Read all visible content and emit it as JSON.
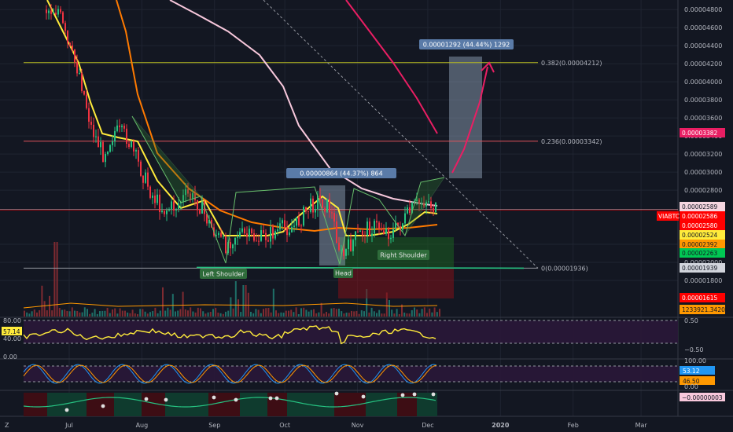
{
  "chart_data": {
    "type": "line",
    "symbol": "VIABTC",
    "x_labels": [
      "Jul",
      "Aug",
      "Sep",
      "Oct",
      "Nov",
      "Dec",
      "2020",
      "Feb",
      "Mar"
    ],
    "y_ticks": [
      "0.00004800",
      "0.00004600",
      "0.00004400",
      "0.00004200",
      "0.00004000",
      "0.00003800",
      "0.00003600",
      "0.00003400",
      "0.00003200",
      "0.00003000",
      "0.00002800",
      "0.00002200",
      "0.00002000",
      "0.00001800"
    ],
    "ylim": [
      1.4e-05,
      4.88e-05
    ],
    "price_tags": [
      {
        "value": "0.00003382",
        "bg": "#e91e63",
        "fg": "#ffffff"
      },
      {
        "value": "0.00002589",
        "bg": "#f5d6e0",
        "fg": "#131722"
      },
      {
        "value": "0.00002586",
        "bg": "#ff0000",
        "fg": "#ffffff",
        "label": "VIABTC"
      },
      {
        "value": "0.00002580",
        "bg": "#ff0000",
        "fg": "#ffffff"
      },
      {
        "value": "0.00002524",
        "bg": "#ffeb3b",
        "fg": "#131722"
      },
      {
        "value": "0.00002392",
        "bg": "#ff9800",
        "fg": "#131722"
      },
      {
        "value": "0.00002263",
        "bg": "#00c853",
        "fg": "#131722"
      },
      {
        "value": "0.00001939",
        "bg": "#d1d4dc",
        "fg": "#131722"
      },
      {
        "value": "0.00001615",
        "bg": "#ff0000",
        "fg": "#ffffff"
      },
      {
        "value": "1233921.34200000",
        "bg": "#ff9800",
        "fg": "#131722"
      }
    ],
    "fib_levels": [
      {
        "ratio": "0.382",
        "label": "0.382(0.00004212)",
        "value": 4.212e-05,
        "color": "#b5b823"
      },
      {
        "ratio": "0.236",
        "label": "0.236(0.00003342)",
        "value": 3.342e-05,
        "color": "#e0525a"
      },
      {
        "ratio": "0",
        "label": "0(0.00001936)",
        "value": 1.936e-05,
        "color": "#9598a1"
      }
    ],
    "price_series": {
      "name": "VIABTC",
      "x": [
        "2019-06-26",
        "2019-06-30",
        "2019-07-05",
        "2019-07-10",
        "2019-07-15",
        "2019-07-20",
        "2019-07-25",
        "2019-07-30",
        "2019-08-05",
        "2019-08-10",
        "2019-08-15",
        "2019-08-20",
        "2019-08-25",
        "2019-08-30",
        "2019-09-05",
        "2019-09-10",
        "2019-09-15",
        "2019-09-20",
        "2019-09-25",
        "2019-09-30",
        "2019-10-05",
        "2019-10-10",
        "2019-10-15",
        "2019-10-20",
        "2019-10-25",
        "2019-10-30",
        "2019-11-05",
        "2019-11-10",
        "2019-11-15",
        "2019-11-20",
        "2019-11-25",
        "2019-11-30",
        "2019-12-05",
        "2019-12-08"
      ],
      "y": [
        4.8e-05,
        4.4e-05,
        4.1e-05,
        3.5e-05,
        3.2e-05,
        3.45e-05,
        3.4e-05,
        3.1e-05,
        2.75e-05,
        2.58e-05,
        2.62e-05,
        2.75e-05,
        2.65e-05,
        2.4e-05,
        2.18e-05,
        2.32e-05,
        2.28e-05,
        2.26e-05,
        2.32e-05,
        2.38e-05,
        2.4e-05,
        2.58e-05,
        2.7e-05,
        2.6e-05,
        2.05e-05,
        2.25e-05,
        2.38e-05,
        2.4e-05,
        2.32e-05,
        2.45e-05,
        2.62e-05,
        2.7e-05,
        2.55e-05,
        2.59e-05
      ]
    },
    "ma_lines": [
      {
        "name": "MA yellow",
        "color": "#ffeb3b"
      },
      {
        "name": "MA orange",
        "color": "#ff7a00"
      },
      {
        "name": "MA pink",
        "color": "#f8c8dc"
      },
      {
        "name": "MA magenta",
        "color": "#e91e63"
      }
    ],
    "annotations": {
      "measure_1": "0.00000864 (44.37%) 864",
      "measure_2": "0.00001292 (44.44%) 1292",
      "left_shoulder": "Left Shoulder",
      "head": "Head",
      "right_shoulder": "Right Shoulder"
    },
    "rsi": {
      "levels": [
        "80.00",
        "40.00",
        "0.00"
      ],
      "value_tag": "57.14",
      "right_labels": [
        "0.50",
        "−0.50"
      ]
    },
    "stoch": {
      "right_labels": [
        "100.00",
        "0.00"
      ],
      "k_tag": "53.12",
      "d_tag": "46.50"
    },
    "macd": {
      "value_tag": "−0.00000003"
    }
  }
}
